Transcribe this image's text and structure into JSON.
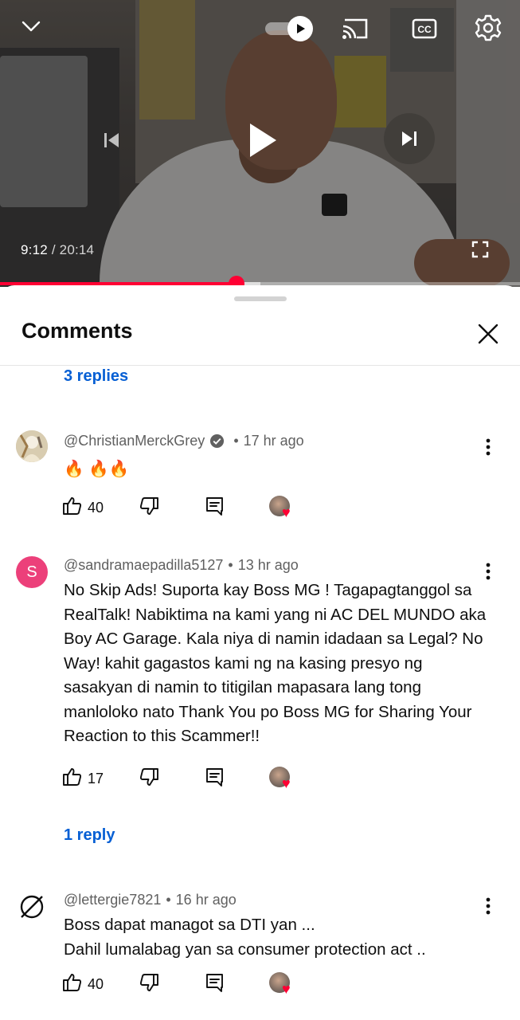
{
  "player": {
    "current_time": "9:12",
    "separator": " / ",
    "duration": "20:14",
    "progress_fraction": 0.455,
    "buffer_fraction": 0.5,
    "icons": [
      "chevron-down-icon",
      "autoplay-toggle",
      "cast-icon",
      "cc-icon",
      "gear-icon",
      "previous-icon",
      "play-icon",
      "next-icon",
      "fullscreen-icon"
    ]
  },
  "sheet": {
    "title": "Comments"
  },
  "threads": [
    {
      "replies_label": "3 replies"
    }
  ],
  "comments": [
    {
      "handle": "@ChristianMerckGrey",
      "verified": true,
      "age": "17 hr ago",
      "text": "🔥 🔥🔥",
      "likes": "40",
      "avatar_letter": ""
    },
    {
      "handle": "@sandramaepadilla5127",
      "verified": false,
      "age": "13 hr ago",
      "text": "No Skip Ads! Suporta kay Boss MG ! Tagapagtanggol sa RealTalk! Nabiktima na kami yang ni AC DEL MUNDO aka Boy AC Garage. Kala niya di namin idadaan sa Legal? No Way! kahit gagastos kami ng na kasing presyo ng sasakyan di namin to titigilan mapasara lang tong manloloko nato Thank You po Boss MG for Sharing Your Reaction to this Scammer!!",
      "likes": "17",
      "avatar_letter": "S",
      "replies_label": "1 reply"
    },
    {
      "handle": "@lettergie7821",
      "verified": false,
      "age": "16 hr ago",
      "text_line1": "Boss dapat managot sa DTI yan ...",
      "text_line2": "Dahil lumalabag yan sa consumer protection act ..",
      "likes": "40",
      "avatar_letter": ""
    }
  ],
  "colors": {
    "accent_red": "#ff0033",
    "link_blue": "#065fd4",
    "secondary_text": "#606060",
    "avatar_pink": "#ec407a"
  }
}
